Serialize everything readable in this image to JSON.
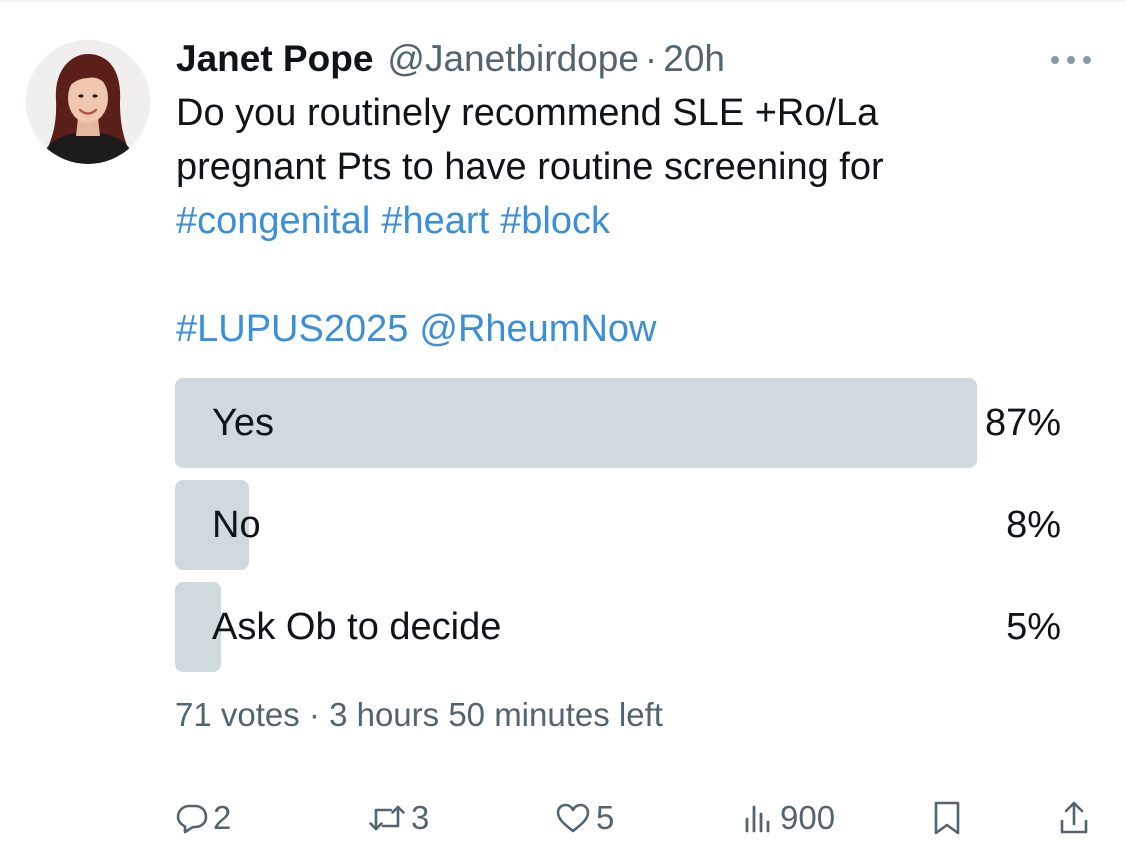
{
  "tweet": {
    "author": {
      "display_name": "Janet Pope",
      "handle": "@Janetbirdope",
      "separator": "·",
      "time": "20h"
    },
    "text_lines": [
      "Do you routinely recommend SLE +Ro/La",
      "pregnant Pts to have routine screening for"
    ],
    "hashtags_line1": [
      "#congenital",
      "#heart",
      "#block"
    ],
    "tags_line2": [
      "#LUPUS2025",
      "@RheumNow"
    ]
  },
  "poll": {
    "options": [
      {
        "label": "Yes",
        "percent_text": "87%",
        "percent": 87
      },
      {
        "label": "No",
        "percent_text": "8%",
        "percent": 8
      },
      {
        "label": "Ask Ob to decide",
        "percent_text": "5%",
        "percent": 5
      }
    ],
    "meta": "71 votes · 3 hours 50 minutes left"
  },
  "actions": {
    "replies": "2",
    "reposts": "3",
    "likes": "5",
    "views": "900"
  },
  "icons": {
    "more": "more-horizontal-icon",
    "reply": "reply-bubble-icon",
    "repost": "repost-arrows-icon",
    "like": "heart-icon",
    "views": "views-bars-icon",
    "bookmark": "bookmark-icon",
    "share": "share-upload-icon"
  },
  "colors": {
    "link": "#3b8fd9",
    "secondary_text": "#536471",
    "poll_bar": "#cfd9de"
  }
}
